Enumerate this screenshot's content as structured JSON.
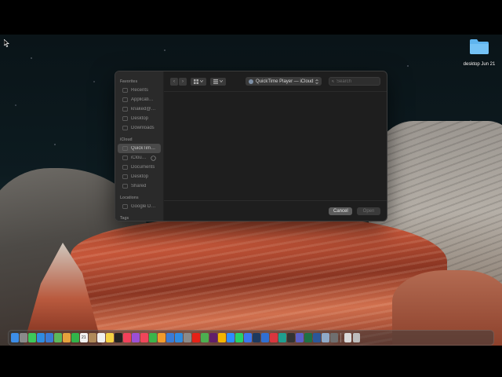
{
  "desktop": {
    "folder_label": "desktop Jun 21"
  },
  "dialog": {
    "sidebar": {
      "favorites_header": "Favorites",
      "favorites": [
        {
          "label": "Recents",
          "icon": "clock-icon"
        },
        {
          "label": "Applications",
          "icon": "applications-icon"
        },
        {
          "label": "knaked@pm...",
          "icon": "home-icon"
        },
        {
          "label": "Desktop",
          "icon": "desktop-icon"
        },
        {
          "label": "Downloads",
          "icon": "downloads-icon"
        }
      ],
      "icloud_header": "iCloud",
      "icloud": [
        {
          "label": "QuickTime...",
          "icon": "folder-icon",
          "selected": true
        },
        {
          "label": "iCloud D...",
          "icon": "icloud-icon"
        },
        {
          "label": "Documents",
          "icon": "documents-icon"
        },
        {
          "label": "Desktop",
          "icon": "desktop-icon"
        },
        {
          "label": "Shared",
          "icon": "shared-folder-icon"
        }
      ],
      "locations_header": "Locations",
      "locations": [
        {
          "label": "Google Drive",
          "icon": "drive-icon"
        }
      ],
      "tags_header": "Tags"
    },
    "toolbar": {
      "back_glyph": "‹",
      "forward_glyph": "›",
      "location": "QuickTime Player — iCloud",
      "search_placeholder": "Search"
    },
    "footer": {
      "cancel_label": "Cancel",
      "open_label": "Open"
    }
  },
  "dock": {
    "calendar_day": "21",
    "apps": [
      {
        "name": "finder-icon",
        "color": "#3d8ee8"
      },
      {
        "name": "launchpad-icon",
        "color": "#8a8a8a"
      },
      {
        "name": "messages-icon",
        "color": "#3cc85a"
      },
      {
        "name": "safari-icon",
        "color": "#2f8be0"
      },
      {
        "name": "mail-icon",
        "color": "#3a7bd5"
      },
      {
        "name": "maps-icon",
        "color": "#5cb85c"
      },
      {
        "name": "photos-icon",
        "color": "#e6a23c"
      },
      {
        "name": "facetime-icon",
        "color": "#32b34a"
      },
      {
        "name": "calendar-icon",
        "color": "#f2f2f2"
      },
      {
        "name": "contacts-icon",
        "color": "#b08a5a"
      },
      {
        "name": "reminders-icon",
        "color": "#f0f0f0"
      },
      {
        "name": "notes-icon",
        "color": "#f5d142"
      },
      {
        "name": "tv-icon",
        "color": "#222222"
      },
      {
        "name": "music-icon",
        "color": "#f2405a"
      },
      {
        "name": "podcasts-icon",
        "color": "#9b4fd6"
      },
      {
        "name": "news-icon",
        "color": "#f0455a"
      },
      {
        "name": "numbers-icon",
        "color": "#3bb54a"
      },
      {
        "name": "pages-icon",
        "color": "#f29b2c"
      },
      {
        "name": "keynote-icon",
        "color": "#3a7bd5"
      },
      {
        "name": "appstore-icon",
        "color": "#2f8be0"
      },
      {
        "name": "settings-icon",
        "color": "#8a8a8a"
      },
      {
        "name": "youtube-icon",
        "color": "#e62117"
      },
      {
        "name": "chrome-icon",
        "color": "#4caf50"
      },
      {
        "name": "slack-icon",
        "color": "#611f69"
      },
      {
        "name": "drive-icon",
        "color": "#f4b400"
      },
      {
        "name": "zoom-icon",
        "color": "#2d8cff"
      },
      {
        "name": "whatsapp-icon",
        "color": "#25d366"
      },
      {
        "name": "signal-icon",
        "color": "#3a76f0"
      },
      {
        "name": "photoshop-icon",
        "color": "#1e3a5f"
      },
      {
        "name": "app-blue-icon",
        "color": "#2f6fd1"
      },
      {
        "name": "app-red-icon",
        "color": "#d9363e"
      },
      {
        "name": "app-teal-icon",
        "color": "#1f9e8f"
      },
      {
        "name": "github-icon",
        "color": "#333333"
      },
      {
        "name": "teams-icon",
        "color": "#5b5fc7"
      },
      {
        "name": "excel-icon",
        "color": "#1e7145"
      },
      {
        "name": "word-icon",
        "color": "#2b579a"
      },
      {
        "name": "preview-icon",
        "color": "#8fa9c8"
      },
      {
        "name": "app-gray-icon",
        "color": "#6f6f6f"
      }
    ],
    "trash": {
      "name": "trash-icon",
      "color": "#bdbdbd"
    },
    "downloads": {
      "name": "downloads-stack-icon",
      "color": "#d9d9d9"
    }
  }
}
